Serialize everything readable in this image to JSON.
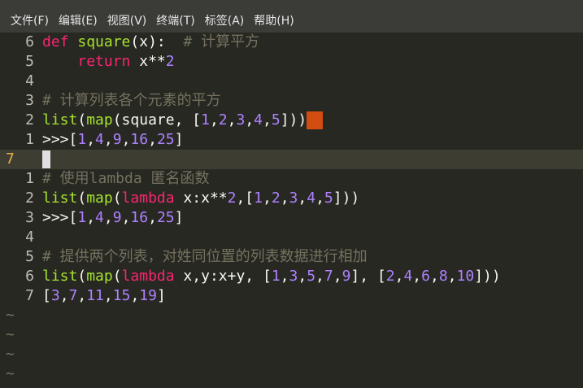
{
  "menubar": {
    "items": [
      {
        "label": "文件(F)"
      },
      {
        "label": "编辑(E)"
      },
      {
        "label": "视图(V)"
      },
      {
        "label": "终端(T)"
      },
      {
        "label": "标签(A)"
      },
      {
        "label": "帮助(H)"
      }
    ]
  },
  "editor": {
    "current_line_number": "7",
    "tilde": "~",
    "lines": [
      {
        "num": "6",
        "tokens": [
          {
            "t": "def",
            "c": "kw-def"
          },
          {
            "t": " ",
            "c": "plain"
          },
          {
            "t": "square",
            "c": "fn"
          },
          {
            "t": "(x):  ",
            "c": "plain"
          },
          {
            "t": "# 计算平方",
            "c": "cmt"
          }
        ]
      },
      {
        "num": "5",
        "tokens": [
          {
            "t": "    ",
            "c": "plain"
          },
          {
            "t": "return",
            "c": "kw"
          },
          {
            "t": " x**",
            "c": "plain"
          },
          {
            "t": "2",
            "c": "num"
          }
        ]
      },
      {
        "num": "4",
        "tokens": []
      },
      {
        "num": "3",
        "tokens": [
          {
            "t": "# 计算列表各个元素的平方",
            "c": "cmt"
          }
        ]
      },
      {
        "num": "2",
        "tokens": [
          {
            "t": "list",
            "c": "fn"
          },
          {
            "t": "(",
            "c": "plain"
          },
          {
            "t": "map",
            "c": "fn"
          },
          {
            "t": "(square, [",
            "c": "plain"
          },
          {
            "t": "1",
            "c": "num"
          },
          {
            "t": ",",
            "c": "plain"
          },
          {
            "t": "2",
            "c": "num"
          },
          {
            "t": ",",
            "c": "plain"
          },
          {
            "t": "3",
            "c": "num"
          },
          {
            "t": ",",
            "c": "plain"
          },
          {
            "t": "4",
            "c": "num"
          },
          {
            "t": ",",
            "c": "plain"
          },
          {
            "t": "5",
            "c": "num"
          },
          {
            "t": "]))",
            "c": "plain"
          }
        ],
        "cursor_block": true
      },
      {
        "num": "1",
        "tokens": [
          {
            "t": ">>>[",
            "c": "plain"
          },
          {
            "t": "1",
            "c": "num"
          },
          {
            "t": ",",
            "c": "plain"
          },
          {
            "t": "4",
            "c": "num"
          },
          {
            "t": ",",
            "c": "plain"
          },
          {
            "t": "9",
            "c": "num"
          },
          {
            "t": ",",
            "c": "plain"
          },
          {
            "t": "16",
            "c": "num"
          },
          {
            "t": ",",
            "c": "plain"
          },
          {
            "t": "25",
            "c": "num"
          },
          {
            "t": "]",
            "c": "plain"
          }
        ]
      },
      {
        "num": "7",
        "current": true,
        "tokens": [],
        "cursor_bar": true
      },
      {
        "num": "1",
        "tokens": [
          {
            "t": "# 使用lambda 匿名函数",
            "c": "cmt"
          }
        ]
      },
      {
        "num": "2",
        "tokens": [
          {
            "t": "list",
            "c": "fn"
          },
          {
            "t": "(",
            "c": "plain"
          },
          {
            "t": "map",
            "c": "fn"
          },
          {
            "t": "(",
            "c": "plain"
          },
          {
            "t": "lambda",
            "c": "kw"
          },
          {
            "t": " x:x**",
            "c": "plain"
          },
          {
            "t": "2",
            "c": "num"
          },
          {
            "t": ",[",
            "c": "plain"
          },
          {
            "t": "1",
            "c": "num"
          },
          {
            "t": ",",
            "c": "plain"
          },
          {
            "t": "2",
            "c": "num"
          },
          {
            "t": ",",
            "c": "plain"
          },
          {
            "t": "3",
            "c": "num"
          },
          {
            "t": ",",
            "c": "plain"
          },
          {
            "t": "4",
            "c": "num"
          },
          {
            "t": ",",
            "c": "plain"
          },
          {
            "t": "5",
            "c": "num"
          },
          {
            "t": "]))",
            "c": "plain"
          }
        ]
      },
      {
        "num": "3",
        "tokens": [
          {
            "t": ">>>[",
            "c": "plain"
          },
          {
            "t": "1",
            "c": "num"
          },
          {
            "t": ",",
            "c": "plain"
          },
          {
            "t": "4",
            "c": "num"
          },
          {
            "t": ",",
            "c": "plain"
          },
          {
            "t": "9",
            "c": "num"
          },
          {
            "t": ",",
            "c": "plain"
          },
          {
            "t": "16",
            "c": "num"
          },
          {
            "t": ",",
            "c": "plain"
          },
          {
            "t": "25",
            "c": "num"
          },
          {
            "t": "]",
            "c": "plain"
          }
        ]
      },
      {
        "num": "4",
        "tokens": []
      },
      {
        "num": "5",
        "tokens": [
          {
            "t": "# 提供两个列表，对姓同位置的列表数据进行相加",
            "c": "cmt"
          }
        ]
      },
      {
        "num": "6",
        "tokens": [
          {
            "t": "list",
            "c": "fn"
          },
          {
            "t": "(",
            "c": "plain"
          },
          {
            "t": "map",
            "c": "fn"
          },
          {
            "t": "(",
            "c": "plain"
          },
          {
            "t": "lambda",
            "c": "kw"
          },
          {
            "t": " x,y:x+y, [",
            "c": "plain"
          },
          {
            "t": "1",
            "c": "num"
          },
          {
            "t": ",",
            "c": "plain"
          },
          {
            "t": "3",
            "c": "num"
          },
          {
            "t": ",",
            "c": "plain"
          },
          {
            "t": "5",
            "c": "num"
          },
          {
            "t": ",",
            "c": "plain"
          },
          {
            "t": "7",
            "c": "num"
          },
          {
            "t": ",",
            "c": "plain"
          },
          {
            "t": "9",
            "c": "num"
          },
          {
            "t": "], [",
            "c": "plain"
          },
          {
            "t": "2",
            "c": "num"
          },
          {
            "t": ",",
            "c": "plain"
          },
          {
            "t": "4",
            "c": "num"
          },
          {
            "t": ",",
            "c": "plain"
          },
          {
            "t": "6",
            "c": "num"
          },
          {
            "t": ",",
            "c": "plain"
          },
          {
            "t": "8",
            "c": "num"
          },
          {
            "t": ",",
            "c": "plain"
          },
          {
            "t": "10",
            "c": "num"
          },
          {
            "t": "]))",
            "c": "plain"
          }
        ]
      },
      {
        "num": "7",
        "tokens": [
          {
            "t": "[",
            "c": "plain"
          },
          {
            "t": "3",
            "c": "num"
          },
          {
            "t": ",",
            "c": "plain"
          },
          {
            "t": "7",
            "c": "num"
          },
          {
            "t": ",",
            "c": "plain"
          },
          {
            "t": "11",
            "c": "num"
          },
          {
            "t": ",",
            "c": "plain"
          },
          {
            "t": "15",
            "c": "num"
          },
          {
            "t": ",",
            "c": "plain"
          },
          {
            "t": "19",
            "c": "num"
          },
          {
            "t": "]",
            "c": "plain"
          }
        ]
      }
    ],
    "tilde_rows": [
      "~",
      "~",
      "~",
      "~"
    ]
  },
  "colors": {
    "background": "#272822",
    "menubar": "#3b3b37",
    "keyword": "#f92672",
    "function": "#a6e22e",
    "number": "#ae81ff",
    "comment": "#75715e",
    "cursor_block": "#d24e10",
    "current_line_number": "#e8b04a"
  }
}
